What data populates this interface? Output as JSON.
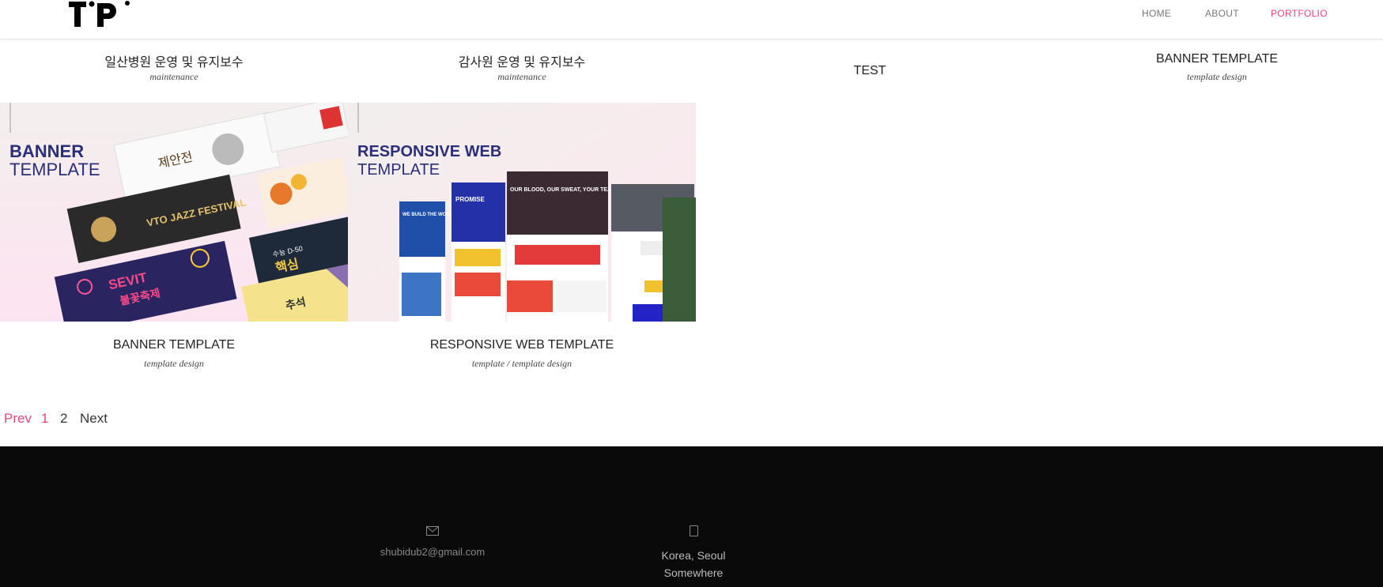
{
  "nav": {
    "home": "HOME",
    "about": "ABOUT",
    "portfolio": "PORTFOLIO",
    "active_color": "#e8467c"
  },
  "cards_top": [
    {
      "title": "일산병원 운영 및 유지보수",
      "subtitle": "maintenance"
    },
    {
      "title": "감사원 운영 및 유지보수",
      "subtitle": "maintenance"
    },
    {
      "title": "TEST",
      "subtitle": ""
    },
    {
      "title": "BANNER TEMPLATE",
      "subtitle": "template design"
    }
  ],
  "cards_bottom": [
    {
      "title": "BANNER TEMPLATE",
      "subtitle": "template design",
      "thumb": {
        "heading1": "BANNER",
        "heading2": "TEMPLATE",
        "banner1": "제안전",
        "banner2": "VTO JAZZ FESTIVAL",
        "banner3": "SEVIT",
        "banner3b": "불꽃축제",
        "banner4": "수능 D-50",
        "banner4b": "핵심",
        "banner5": "추석"
      }
    },
    {
      "title": "RESPONSIVE WEB TEMPLATE",
      "subtitle": "template / template design",
      "thumb": {
        "heading1": "RESPONSIVE WEB",
        "heading2": "TEMPLATE",
        "s1": "WE BUILD THE WORLD",
        "s2": "PROMISE",
        "s3": "OUR BLOOD, OUR SWEAT, YOUR TEARS"
      }
    }
  ],
  "pagination": {
    "prev": "Prev",
    "page1": "1",
    "page2": "2",
    "next": "Next"
  },
  "footer": {
    "email_icon": "envelope-icon",
    "email": "shubidub2@gmail.com",
    "location_icon": "mobile-icon",
    "location_line1": "Korea, Seoul",
    "location_line2": "Somewhere"
  }
}
